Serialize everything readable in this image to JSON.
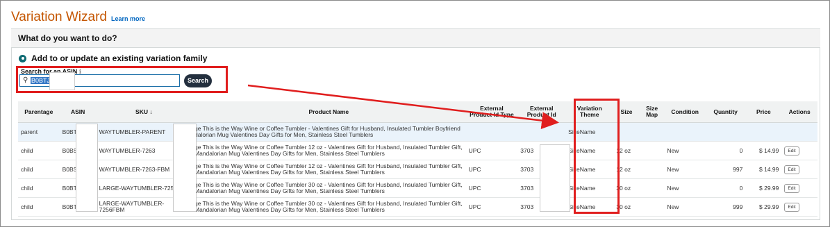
{
  "header": {
    "title": "Variation Wizard",
    "learn_more": "Learn more"
  },
  "panel": {
    "question": "What do you want to do?"
  },
  "option": {
    "label": "Add to or update an existing variation family"
  },
  "search": {
    "label": "Search for an ASIN",
    "info_icon": "ℹ",
    "value": "B0BTJ",
    "button": "Search"
  },
  "table": {
    "headers": {
      "parentage": "Parentage",
      "asin": "ASIN",
      "sku": "SKU ↓",
      "product_name": "Product Name",
      "ext_type": "External Product Id Type",
      "ext_id": "External Product Id",
      "theme": "Variation Theme",
      "size": "Size",
      "size_map": "Size Map",
      "condition": "Condition",
      "quantity": "Quantity",
      "price": "Price",
      "actions": "Actions"
    },
    "rows": [
      {
        "parentage": "parent",
        "asin": "B0BT",
        "sku": "WAYTUMBLER-PARENT",
        "name": "ge This is the Way Wine or Coffee Tumbler - Valentines Gift for Husband, Insulated Tumbler Boyfriend dalorian Mug Valentines Day Gifts for Men, Stainless Steel Tumblers",
        "ext_type": "",
        "ext_id": "",
        "theme": "SizeName",
        "size": "",
        "condition": "",
        "quantity": "",
        "price": "",
        "action": ""
      },
      {
        "parentage": "child",
        "asin": "B0BS",
        "sku": "WAYTUMBLER-7263",
        "name": "ge This is the Way Wine or Coffee Tumbler 12 oz - Valentines Gift for Husband, Insulated Tumbler Gift, Mandalorian Mug Valentines Day Gifts for Men, Stainless Steel Tumblers",
        "ext_type": "UPC",
        "ext_id": "3703",
        "theme": "SizeName",
        "size": "12 oz",
        "condition": "New",
        "quantity": "0",
        "price": "$ 14.99",
        "action": "Edit"
      },
      {
        "parentage": "child",
        "asin": "B0BS",
        "sku": "WAYTUMBLER-7263-FBM",
        "name": "ge This is the Way Wine or Coffee Tumbler 12 oz - Valentines Gift for Husband, Insulated Tumbler Gift, Mandalorian Mug Valentines Day Gifts for Men, Stainless Steel Tumblers",
        "ext_type": "UPC",
        "ext_id": "3703",
        "theme": "SizeName",
        "size": "12 oz",
        "condition": "New",
        "quantity": "997",
        "price": "$ 14.99",
        "action": "Edit"
      },
      {
        "parentage": "child",
        "asin": "B0BT",
        "sku": "LARGE-WAYTUMBLER-7256",
        "name": "ge This is the Way Wine or Coffee Tumbler 30 oz - Valentines Gift for Husband, Insulated Tumbler Gift, Mandalorian Mug Valentines Day Gifts for Men, Stainless Steel Tumblers",
        "ext_type": "UPC",
        "ext_id": "3703",
        "theme": "SizeName",
        "size": "30 oz",
        "condition": "New",
        "quantity": "0",
        "price": "$ 29.99",
        "action": "Edit"
      },
      {
        "parentage": "child",
        "asin": "B0BT",
        "sku": "LARGE-WAYTUMBLER-7256FBM",
        "name": "ge This is the Way Wine or Coffee Tumbler 30 oz - Valentines Gift for Husband, Insulated Tumbler Gift, Mandalorian Mug Valentines Day Gifts for Men, Stainless Steel Tumblers",
        "ext_type": "UPC",
        "ext_id": "3703",
        "theme": "SizeName",
        "size": "30 oz",
        "condition": "New",
        "quantity": "999",
        "price": "$ 29.99",
        "action": "Edit"
      }
    ]
  },
  "colors": {
    "title": "#c45500",
    "highlight_red": "#e01e1e",
    "search_btn": "#232f3e",
    "radio": "#0f6b73"
  }
}
